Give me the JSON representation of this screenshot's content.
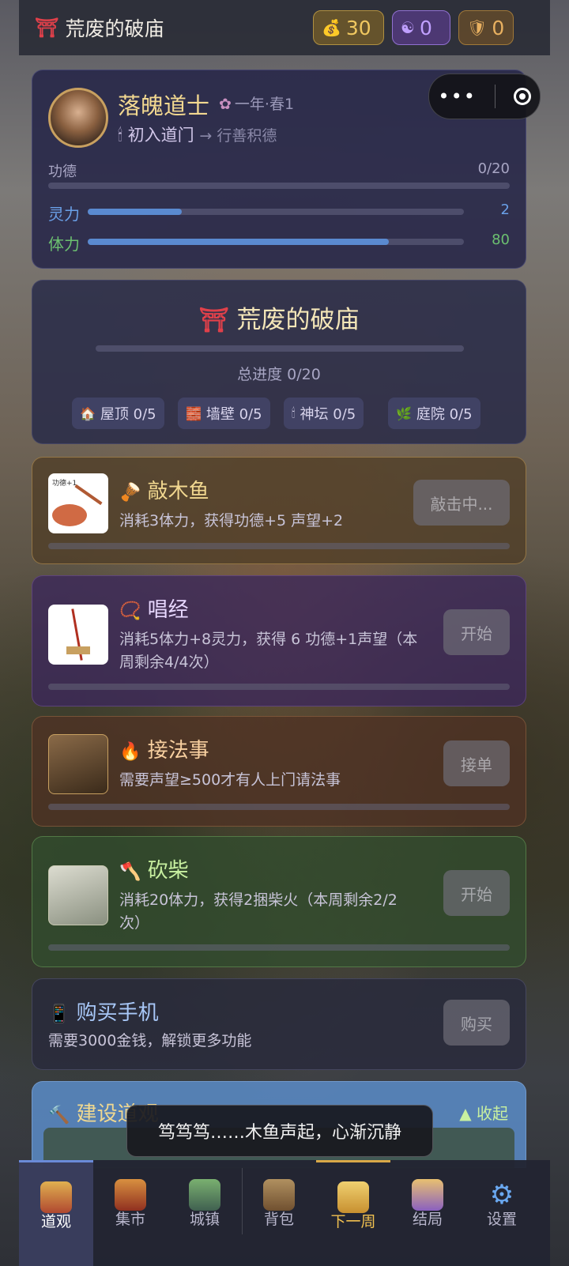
{
  "colors": {
    "accent_gold": "#f0c860",
    "merit_bar": "#5a8ad0",
    "stamina_value": "#6cc070"
  },
  "header": {
    "title": "荒废的破庙",
    "gold": "30",
    "yinyang": "0",
    "shield": "0"
  },
  "profile": {
    "name": "落魄道士",
    "season": "一年·春1",
    "rank": "初入道门",
    "next_rank": "行善积德",
    "merit": {
      "label": "功德",
      "value": "0/20",
      "fraction": 0.0
    },
    "spirit": {
      "label": "灵力",
      "value": "2",
      "fraction": 0.25
    },
    "stamina": {
      "label": "体力",
      "value": "80",
      "fraction": 0.8
    }
  },
  "temple": {
    "title": "荒废的破庙",
    "total": "总进度 0/20",
    "parts": [
      {
        "label": "屋顶 0/5",
        "icon": "house-icon"
      },
      {
        "label": "墙壁 0/5",
        "icon": "brick-icon"
      },
      {
        "label": "神坛 0/5",
        "icon": "candle-icon"
      },
      {
        "label": "庭院 0/5",
        "icon": "herb-icon"
      }
    ]
  },
  "activities": {
    "muyu": {
      "title": "敲木鱼",
      "desc": "消耗3体力，获得功德+5 声望+2",
      "button": "敲击中...",
      "img_label": "功德+1"
    },
    "chant": {
      "title": "唱经",
      "desc": "消耗5体力+8灵力，获得 6 功德+1声望（本周剩余4/4次）",
      "button": "开始"
    },
    "rite": {
      "title": "接法事",
      "desc": "需要声望≥500才有人上门请法事",
      "button": "接单"
    },
    "wood": {
      "title": "砍柴",
      "desc": "消耗20体力，获得2捆柴火（本周剩余2/2次）",
      "button": "开始"
    },
    "phone": {
      "title": "购买手机",
      "desc": "需要3000金钱，解锁更多功能",
      "button": "购买"
    }
  },
  "build": {
    "title": "建设道观",
    "collapse": "▲ 收起"
  },
  "toast": "笃笃笃……木鱼声起，心渐沉静",
  "nav": [
    {
      "label": "道观"
    },
    {
      "label": "集市"
    },
    {
      "label": "城镇"
    },
    {
      "label": "背包"
    },
    {
      "label": "下一周"
    },
    {
      "label": "结局"
    },
    {
      "label": "设置"
    }
  ]
}
